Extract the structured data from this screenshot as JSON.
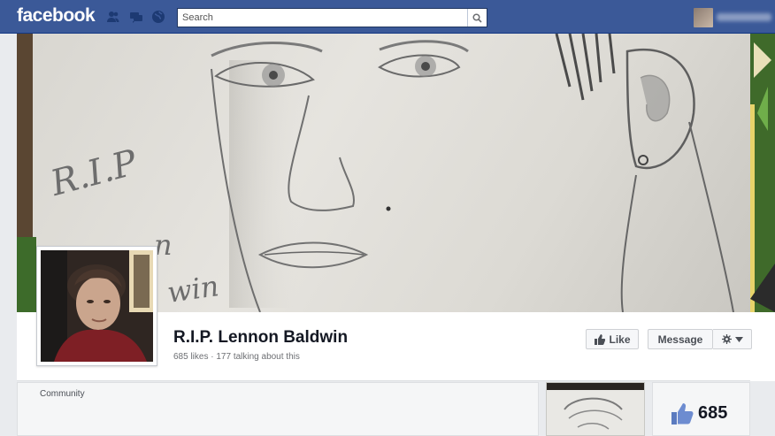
{
  "topbar": {
    "logo": "facebook",
    "search_placeholder": "Search"
  },
  "icons": {
    "friends": "friends-icon",
    "messages": "messages-icon",
    "notifications": "globe-icon",
    "search": "search-icon",
    "like": "thumbs-up-icon",
    "gear": "gear-icon",
    "dropdown": "chevron-down-icon"
  },
  "cover": {
    "drawn_text_line1": "R.I.P",
    "drawn_text_line2": "n",
    "drawn_text_line3": "win"
  },
  "page": {
    "title": "R.I.P. Lennon Baldwin",
    "stats": "685 likes · 177 talking about this"
  },
  "actions": {
    "like_label": "Like",
    "message_label": "Message"
  },
  "about": {
    "category": "Community"
  },
  "likes_box": {
    "count": "685"
  },
  "colors": {
    "brand_blue": "#3b5998",
    "background": "#e9ebee"
  }
}
